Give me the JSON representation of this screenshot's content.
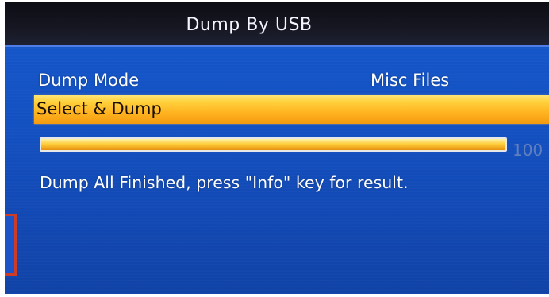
{
  "window": {
    "title": "Dump By USB"
  },
  "menu": {
    "dump_mode_label": "Dump Mode",
    "dump_mode_value": "Misc Files",
    "selected_action": "Select & Dump"
  },
  "progress": {
    "percent": 100,
    "text": "100"
  },
  "status": {
    "message": "Dump All Finished, press \"Info\" key for result."
  },
  "colors": {
    "background": "#1350c0",
    "title_bar": "#161722",
    "highlight": "#ffc52f",
    "progress_fill": "#ffcd3c",
    "progress_text": "#5f7fbf"
  }
}
